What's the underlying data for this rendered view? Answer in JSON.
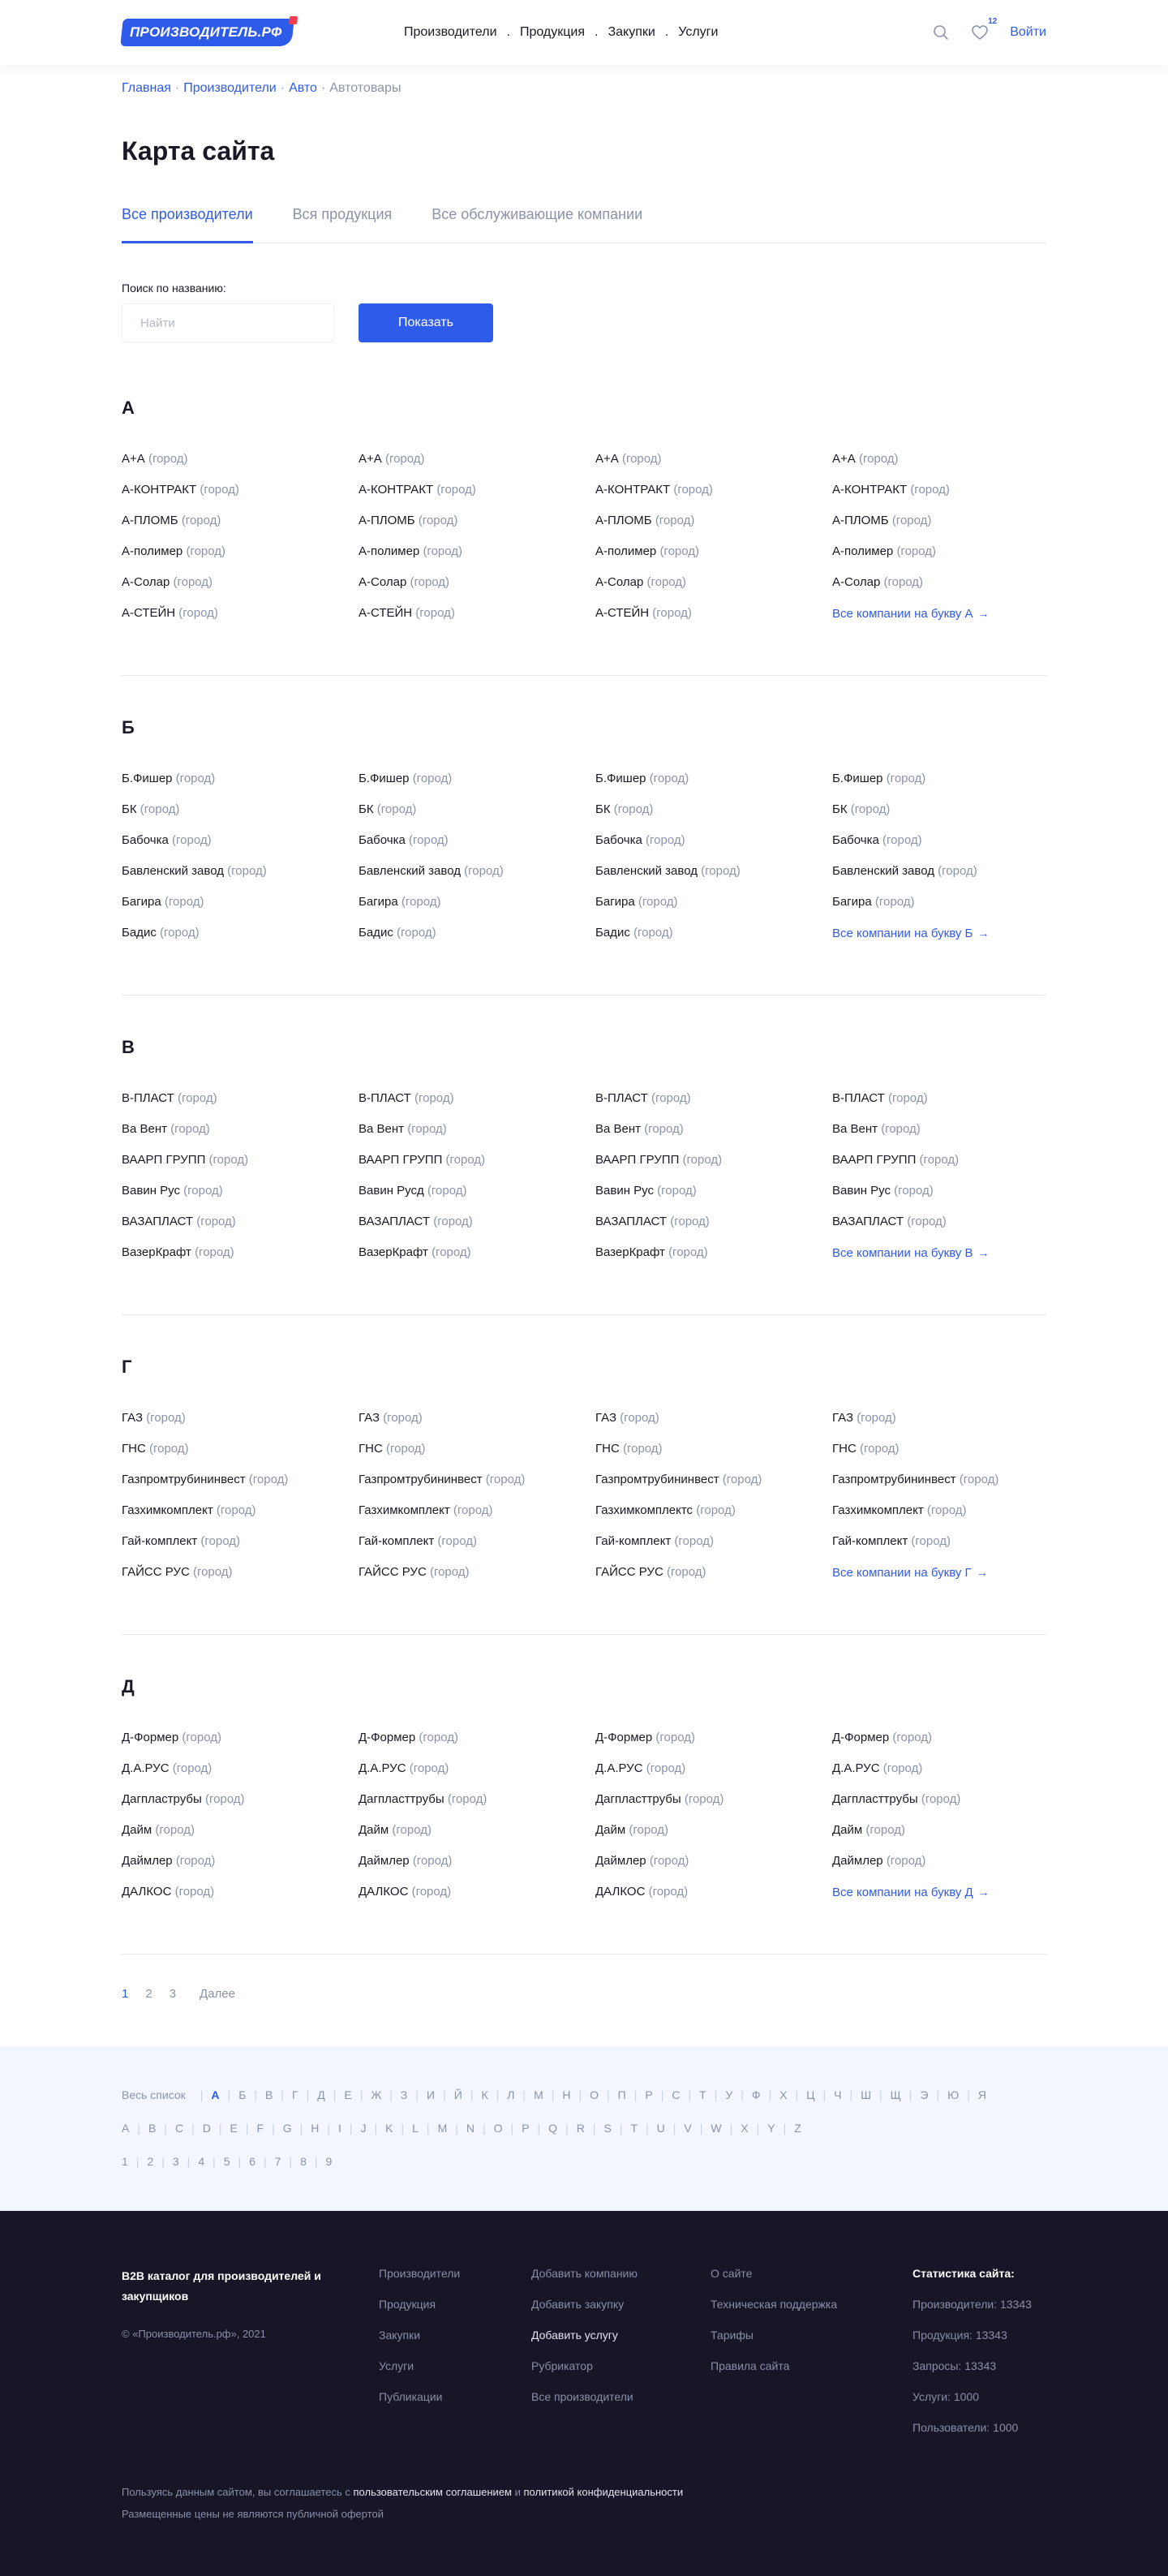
{
  "header": {
    "logo_text": "ПРОИЗВОДИТЕЛЬ.РФ",
    "nav": [
      "Производители",
      "Продукция",
      "Закупки",
      "Услуги"
    ],
    "nav_separator": ".",
    "favorites_count": "12",
    "login_label": "Войти"
  },
  "breadcrumb": {
    "items": [
      "Главная",
      "Производители",
      "Авто"
    ],
    "current": "Автотовары",
    "separator": "·"
  },
  "page_title": "Карта сайта",
  "tabs": [
    {
      "label": "Все производители",
      "active": true
    },
    {
      "label": "Вся продукция",
      "active": false
    },
    {
      "label": "Все обслуживающие компании",
      "active": false
    }
  ],
  "search": {
    "label": "Поиск по названию:",
    "placeholder": "Найти",
    "value": "",
    "button_label": "Показать"
  },
  "sections": [
    {
      "letter": "А",
      "columns": [
        [
          [
            "А+А",
            "(город)"
          ],
          [
            "А-КОНТРАКТ",
            "(город)"
          ],
          [
            "А-ПЛОМБ",
            "(город)"
          ],
          [
            "А-полимер",
            "(город)"
          ],
          [
            "А-Солар",
            "(город)"
          ],
          [
            "А-СТЕЙН",
            "(город)"
          ]
        ],
        [
          [
            "А+А",
            "(город)"
          ],
          [
            "А-КОНТРАКТ",
            "(город)"
          ],
          [
            "А-ПЛОМБ",
            "(город)"
          ],
          [
            "А-полимер",
            "(город)"
          ],
          [
            "А-Солар",
            "(город)"
          ],
          [
            "А-СТЕЙН",
            "(город)"
          ]
        ],
        [
          [
            "А+А",
            "(город)"
          ],
          [
            "А-КОНТРАКТ",
            "(город)"
          ],
          [
            "А-ПЛОМБ",
            "(город)"
          ],
          [
            "А-полимер",
            "(город)"
          ],
          [
            "А-Солар",
            "(город)"
          ],
          [
            "А-СТЕЙН",
            "(город)"
          ]
        ],
        [
          [
            "А+А",
            "(город)"
          ],
          [
            "А-КОНТРАКТ",
            "(город)"
          ],
          [
            "А-ПЛОМБ",
            "(город)"
          ],
          [
            "А-полимер",
            "(город)"
          ],
          [
            "А-Солар",
            "(город)"
          ]
        ]
      ],
      "all_link": "Все компании на букву А"
    },
    {
      "letter": "Б",
      "columns": [
        [
          [
            "Б.Фишер",
            "(город)"
          ],
          [
            "БК",
            "(город)"
          ],
          [
            "Бабочка",
            "(город)"
          ],
          [
            "Бавленский завод",
            "(город)"
          ],
          [
            "Багира",
            "(город)"
          ],
          [
            "Бадис",
            "(город)"
          ]
        ],
        [
          [
            "Б.Фишер",
            "(город)"
          ],
          [
            "БК",
            "(город)"
          ],
          [
            "Бабочка",
            "(город)"
          ],
          [
            "Бавленский завод",
            "(город)"
          ],
          [
            "Багира",
            "(город)"
          ],
          [
            "Бадис",
            "(город)"
          ]
        ],
        [
          [
            "Б.Фишер",
            "(город)"
          ],
          [
            "БК",
            "(город)"
          ],
          [
            "Бабочка",
            "(город)"
          ],
          [
            "Бавленский завод",
            "(город)"
          ],
          [
            "Багира",
            "(город)"
          ],
          [
            "Бадис",
            "(город)"
          ]
        ],
        [
          [
            "Б.Фишер",
            "(город)"
          ],
          [
            "БК",
            "(город)"
          ],
          [
            "Бабочка",
            "(город)"
          ],
          [
            "Бавленский завод",
            "(город)"
          ],
          [
            "Багира",
            "(город)"
          ]
        ]
      ],
      "all_link": "Все компании на букву Б"
    },
    {
      "letter": "В",
      "columns": [
        [
          [
            "В-ПЛАСТ",
            "(город)"
          ],
          [
            "Ва Вент",
            "(город)"
          ],
          [
            "ВААРП ГРУПП",
            "(город)"
          ],
          [
            "Вавин Рус",
            "(город)"
          ],
          [
            "ВАЗАПЛАСТ",
            "(город)"
          ],
          [
            "ВазерКрафт",
            "(город)"
          ]
        ],
        [
          [
            "В-ПЛАСТ",
            "(город)"
          ],
          [
            "Ва Вент",
            "(город)"
          ],
          [
            "ВААРП ГРУПП",
            "(город)"
          ],
          [
            "Вавин Русд",
            "(город)"
          ],
          [
            "ВАЗАПЛАСТ",
            "(город)"
          ],
          [
            "ВазерКрафт",
            "(город)"
          ]
        ],
        [
          [
            "В-ПЛАСТ",
            "(город)"
          ],
          [
            "Ва Вент",
            "(город)"
          ],
          [
            "ВААРП ГРУПП",
            "(город)"
          ],
          [
            "Вавин Рус",
            "(город)"
          ],
          [
            "ВАЗАПЛАСТ",
            "(город)"
          ],
          [
            "ВазерКрафт",
            "(город)"
          ]
        ],
        [
          [
            "В-ПЛАСТ",
            "(город)"
          ],
          [
            "Ва Вент",
            "(город)"
          ],
          [
            "ВААРП ГРУПП",
            "(город)"
          ],
          [
            "Вавин Рус",
            "(город)"
          ],
          [
            "ВАЗАПЛАСТ",
            "(город)"
          ]
        ]
      ],
      "all_link": "Все компании на букву В"
    },
    {
      "letter": "Г",
      "columns": [
        [
          [
            "ГАЗ",
            "(город)"
          ],
          [
            "ГНС",
            "(город)"
          ],
          [
            "Газпромтрубининвест",
            "(город)"
          ],
          [
            "Газхимкомплект",
            "(город)"
          ],
          [
            "Гай-комплект",
            "(город)"
          ],
          [
            "ГАЙСС РУС",
            "(город)"
          ]
        ],
        [
          [
            "ГАЗ",
            "(город)"
          ],
          [
            "ГНС",
            "(город)"
          ],
          [
            "Газпромтрубининвест",
            "(город)"
          ],
          [
            "Газхимкомплект",
            "(город)"
          ],
          [
            "Гай-комплект",
            "(город)"
          ],
          [
            "ГАЙСС РУС",
            "(город)"
          ]
        ],
        [
          [
            "ГАЗ",
            "(город)"
          ],
          [
            "ГНС",
            "(город)"
          ],
          [
            "Газпромтрубининвест",
            "(город)"
          ],
          [
            "Газхимкомплектс",
            "(город)"
          ],
          [
            "Гай-комплект",
            "(город)"
          ],
          [
            "ГАЙСС РУС",
            "(город)"
          ]
        ],
        [
          [
            "ГАЗ",
            "(город)"
          ],
          [
            "ГНС",
            "(город)"
          ],
          [
            "Газпромтрубининвест",
            "(город)"
          ],
          [
            "Газхимкомплект",
            "(город)"
          ],
          [
            "Гай-комплект",
            "(город)"
          ]
        ]
      ],
      "all_link": "Все компании на букву Г"
    },
    {
      "letter": "Д",
      "columns": [
        [
          [
            "Д-Формер",
            "(город)"
          ],
          [
            "Д.А.РУС",
            "(город)"
          ],
          [
            "Дагпластрубы",
            "(город)"
          ],
          [
            "Дайм",
            "(город)"
          ],
          [
            "Даймлер",
            "(город)"
          ],
          [
            "ДАЛКОС",
            "(город)"
          ]
        ],
        [
          [
            "Д-Формер",
            "(город)"
          ],
          [
            "Д.А.РУС",
            "(город)"
          ],
          [
            "Дагпласттрубы",
            "(город)"
          ],
          [
            "Дайм",
            "(город)"
          ],
          [
            "Даймлер",
            "(город)"
          ],
          [
            "ДАЛКОС",
            "(город)"
          ]
        ],
        [
          [
            "Д-Формер",
            "(город)"
          ],
          [
            "Д.А.РУС",
            "(город)"
          ],
          [
            "Дагпласттрубы",
            "(город)"
          ],
          [
            "Дайм",
            "(город)"
          ],
          [
            "Даймлер",
            "(город)"
          ],
          [
            "ДАЛКОС",
            "(город)"
          ]
        ],
        [
          [
            "Д-Формер",
            "(город)"
          ],
          [
            "Д.А.РУС",
            "(город)"
          ],
          [
            "Дагпласттрубы",
            "(город)"
          ],
          [
            "Дайм",
            "(город)"
          ],
          [
            "Даймлер",
            "(город)"
          ]
        ]
      ],
      "all_link": "Все компании на букву Д"
    }
  ],
  "pagination": {
    "pages": [
      "1",
      "2",
      "3"
    ],
    "current": "1",
    "next_label": "Далее"
  },
  "alphabet": {
    "label": "Весь список",
    "active": "А",
    "cyrillic": [
      "А",
      "Б",
      "В",
      "Г",
      "Д",
      "Е",
      "Ж",
      "З",
      "И",
      "Й",
      "К",
      "Л",
      "М",
      "Н",
      "О",
      "П",
      "Р",
      "С",
      "Т",
      "У",
      "Ф",
      "Х",
      "Ц",
      "Ч",
      "Ш",
      "Щ",
      "Э",
      "Ю",
      "Я"
    ],
    "latin": [
      "A",
      "B",
      "C",
      "D",
      "E",
      "F",
      "G",
      "H",
      "I",
      "J",
      "K",
      "L",
      "M",
      "N",
      "O",
      "P",
      "Q",
      "R",
      "S",
      "T",
      "U",
      "V",
      "W",
      "X",
      "Y",
      "Z"
    ],
    "digits": [
      "1",
      "2",
      "3",
      "4",
      "5",
      "6",
      "7",
      "8",
      "9"
    ]
  },
  "footer": {
    "brand": "B2B каталог для производителей и закупщиков",
    "copyright": "© «Производитель.рф», 2021",
    "col1": [
      "Производители",
      "Продукция",
      "Закупки",
      "Услуги",
      "Публикации"
    ],
    "col2": [
      "Добавить компанию",
      "Добавить закупку",
      "Добавить услугу",
      "Рубрикатор",
      "Все производители"
    ],
    "col2_highlight": "Добавить услугу",
    "col3": [
      "О сайте",
      "Техническая поддержка",
      "Тарифы",
      "Правила сайта"
    ],
    "stats_title": "Статистика сайта:",
    "stats": [
      "Производители: 13343",
      "Продукция: 13343",
      "Запросы: 13343",
      "Услуги: 1000",
      "Пользователи: 1000"
    ],
    "agreement_prefix": "Пользуясь данным сайтом, вы соглашаетесь с",
    "agreement_link1": "пользовательским соглашением",
    "agreement_and": "и",
    "agreement_link2": "политикой конфиденциальности",
    "price_note": "Размещенные цены не являются публичной офертой"
  },
  "colors": {
    "accent": "#2f5bea",
    "text": "#1a1a26",
    "muted": "#8a93a8",
    "alphabet_bg": "#f3f6fe",
    "footer_bg": "#161627",
    "logo_dot": "#ff3b4f"
  },
  "icons": {
    "search": "search-icon",
    "favorites": "heart-icon",
    "arrow": "arrow-right-icon"
  }
}
